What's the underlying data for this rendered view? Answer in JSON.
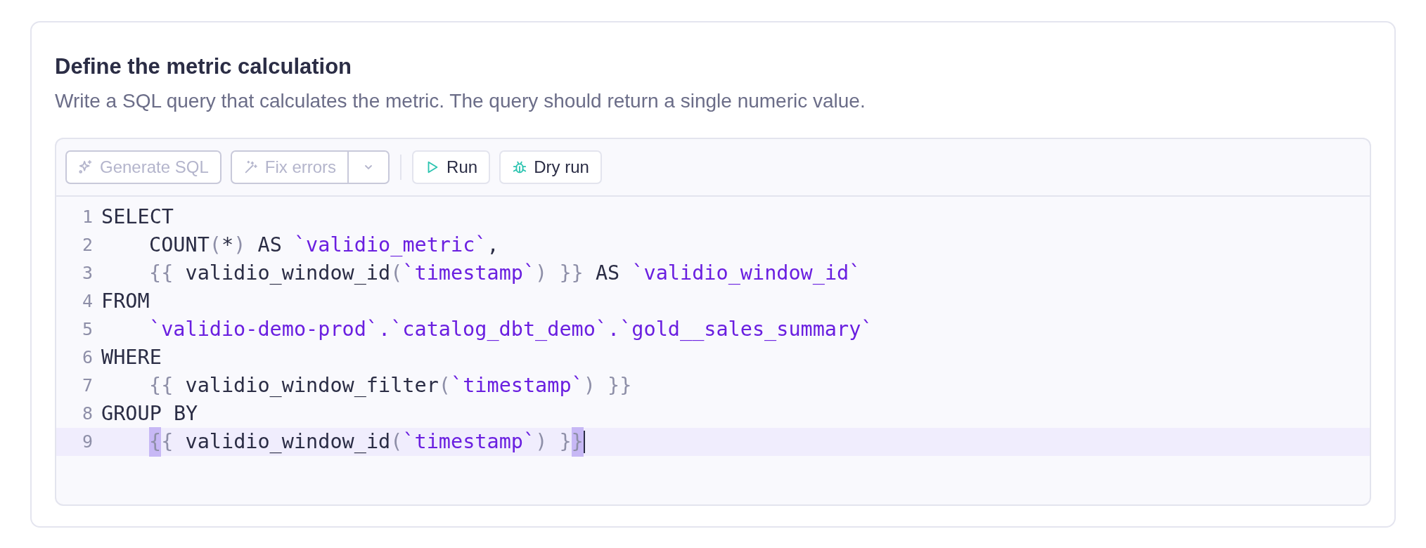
{
  "section": {
    "title": "Define the metric calculation",
    "description": "Write a SQL query that calculates the metric. The query should return a single numeric value."
  },
  "toolbar": [
    {
      "kind": "generate",
      "label": "Generate SQL",
      "disabled": true,
      "has_menu": false
    },
    {
      "kind": "fix",
      "label": "Fix errors",
      "disabled": true,
      "has_menu": true
    },
    {
      "kind": "run",
      "label": "Run",
      "disabled": false,
      "has_menu": false
    },
    {
      "kind": "dry_run",
      "label": "Dry run",
      "disabled": false,
      "has_menu": false
    }
  ],
  "editor": {
    "lines": [
      {
        "number": "1",
        "indent": false,
        "active": false,
        "cursor": false,
        "tokens": [
          {
            "kind": "plain",
            "text": "SELECT"
          }
        ]
      },
      {
        "number": "2",
        "indent": true,
        "active": false,
        "cursor": false,
        "tokens": [
          {
            "kind": "plain",
            "text": "COUNT"
          },
          {
            "kind": "punct",
            "text": "("
          },
          {
            "kind": "plain",
            "text": "*"
          },
          {
            "kind": "punct",
            "text": ")"
          },
          {
            "kind": "plain",
            "text": " AS "
          },
          {
            "kind": "string",
            "text": "`validio_metric`"
          },
          {
            "kind": "plain",
            "text": ","
          }
        ]
      },
      {
        "number": "3",
        "indent": true,
        "active": false,
        "cursor": false,
        "tokens": [
          {
            "kind": "punct",
            "text": "{{"
          },
          {
            "kind": "plain",
            "text": " validio_window_id"
          },
          {
            "kind": "punct",
            "text": "("
          },
          {
            "kind": "string",
            "text": "`timestamp`"
          },
          {
            "kind": "punct",
            "text": ") }}"
          },
          {
            "kind": "plain",
            "text": " AS "
          },
          {
            "kind": "string",
            "text": "`validio_window_id`"
          }
        ]
      },
      {
        "number": "4",
        "indent": false,
        "active": false,
        "cursor": false,
        "tokens": [
          {
            "kind": "plain",
            "text": "FROM"
          }
        ]
      },
      {
        "number": "5",
        "indent": true,
        "active": false,
        "cursor": false,
        "tokens": [
          {
            "kind": "string",
            "text": "`validio-demo-prod`.`catalog_dbt_demo`.`gold__sales_summary`"
          }
        ]
      },
      {
        "number": "6",
        "indent": false,
        "active": false,
        "cursor": false,
        "tokens": [
          {
            "kind": "plain",
            "text": "WHERE"
          }
        ]
      },
      {
        "number": "7",
        "indent": true,
        "active": false,
        "cursor": false,
        "tokens": [
          {
            "kind": "punct",
            "text": "{{"
          },
          {
            "kind": "plain",
            "text": " validio_window_filter"
          },
          {
            "kind": "punct",
            "text": "("
          },
          {
            "kind": "string",
            "text": "`timestamp`"
          },
          {
            "kind": "punct",
            "text": ") }}"
          }
        ]
      },
      {
        "number": "8",
        "indent": false,
        "active": false,
        "cursor": false,
        "tokens": [
          {
            "kind": "plain",
            "text": "GROUP BY"
          }
        ]
      },
      {
        "number": "9",
        "indent": true,
        "active": true,
        "cursor": true,
        "tokens": [
          {
            "kind": "matched",
            "text": "{"
          },
          {
            "kind": "punct",
            "text": "{"
          },
          {
            "kind": "plain",
            "text": " validio_window_id"
          },
          {
            "kind": "punct",
            "text": "("
          },
          {
            "kind": "string",
            "text": "`timestamp`"
          },
          {
            "kind": "punct",
            "text": ") }"
          },
          {
            "kind": "matched",
            "text": "}"
          }
        ]
      }
    ]
  }
}
